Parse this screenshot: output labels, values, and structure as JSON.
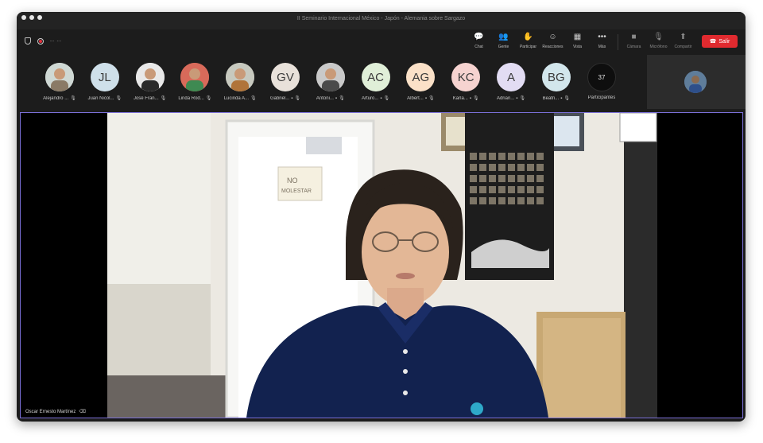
{
  "window": {
    "title": "II Seminario Internacional México - Japón - Alemania sobre Sargazo"
  },
  "toolbar": {
    "recording_text": "-- --",
    "buttons": [
      {
        "label": "Chat",
        "icon": "chat-icon",
        "glyph": "💬"
      },
      {
        "label": "Gente",
        "icon": "people-icon",
        "glyph": "👥"
      },
      {
        "label": "Participar",
        "icon": "raise-hand-icon",
        "glyph": "✋"
      },
      {
        "label": "Reacciones",
        "icon": "smiley-icon",
        "glyph": "☺"
      },
      {
        "label": "Vista",
        "icon": "grid-icon",
        "glyph": "▦"
      },
      {
        "label": "Más",
        "icon": "more-icon",
        "glyph": "•••"
      }
    ],
    "media_buttons": [
      {
        "label": "Cámara",
        "icon": "camera-off-icon",
        "glyph": "■"
      },
      {
        "label": "Micrófono",
        "icon": "mic-off-icon",
        "glyph": "🎙"
      },
      {
        "label": "Compartir",
        "icon": "share-icon",
        "glyph": "⬆"
      }
    ],
    "leave_label": "Salir"
  },
  "participants": [
    {
      "name": "Alejandro ...",
      "initials": "",
      "bg": "#cfd8d4",
      "photo": true,
      "photo_color": "#8a7a66"
    },
    {
      "name": "Juan Nicol...",
      "initials": "JL",
      "bg": "#cfe0ea"
    },
    {
      "name": "José Fran...",
      "initials": "",
      "bg": "#e8e8e8",
      "photo": true,
      "photo_color": "#2a2a2a"
    },
    {
      "name": "Linda Rod...",
      "initials": "",
      "bg": "#d86a5a",
      "photo": true,
      "photo_color": "#3e8a52"
    },
    {
      "name": "Lucinda A...",
      "initials": "",
      "bg": "#c7c9bf",
      "photo": true,
      "photo_color": "#b0743a"
    },
    {
      "name": "Gabriel...",
      "initials": "GV",
      "bg": "#e8e1da"
    },
    {
      "name": "Antoni...",
      "initials": "",
      "bg": "#c9c9c9",
      "photo": true,
      "photo_color": "#4a4a4a"
    },
    {
      "name": "Arturo...",
      "initials": "AC",
      "bg": "#e0efd8"
    },
    {
      "name": "Albert...",
      "initials": "AG",
      "bg": "#fbe1c8"
    },
    {
      "name": "Karla...",
      "initials": "KC",
      "bg": "#f6d3d0"
    },
    {
      "name": "Adrian...",
      "initials": "A",
      "bg": "#e2dcf3"
    },
    {
      "name": "Beatri...",
      "initials": "BG",
      "bg": "#d2e6ec"
    }
  ],
  "participants_count": {
    "count": "37",
    "label": "Participantes"
  },
  "speaker": {
    "name": "Oscar Ernesto Martínez"
  }
}
